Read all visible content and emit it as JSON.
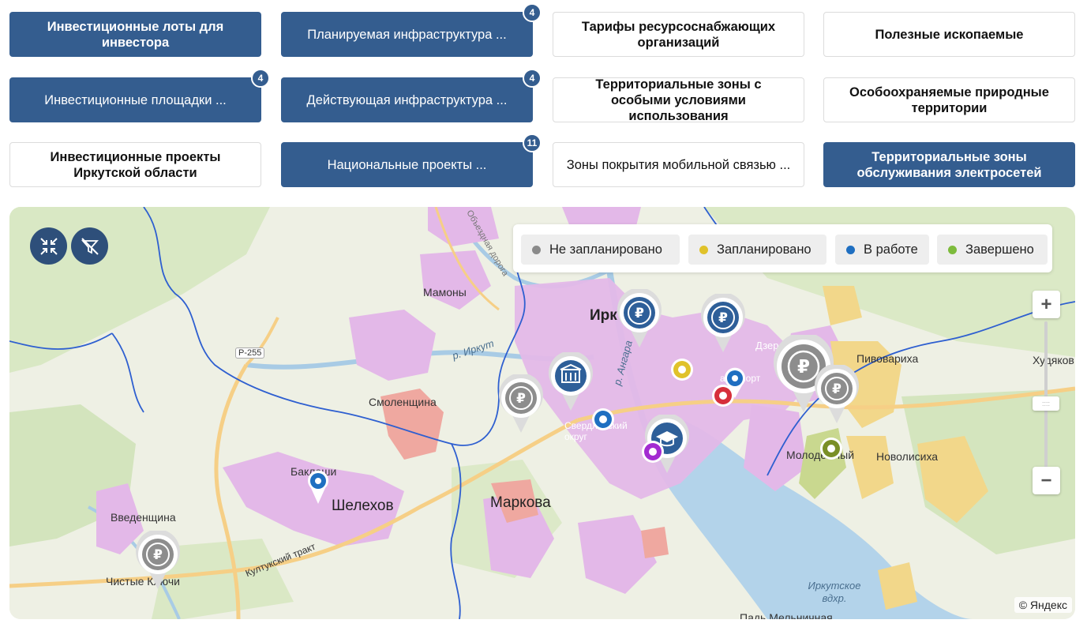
{
  "buttons": [
    {
      "label": "Инвестиционные лоты для инвестора",
      "badge": ""
    },
    {
      "label": "Планируемая инфраструктура ...",
      "badge": "4"
    },
    {
      "label": "Тарифы ресурсоснабжающих организаций",
      "badge": ""
    },
    {
      "label": "Полезные ископаемые",
      "badge": ""
    },
    {
      "label": "Инвестиционные площадки ...",
      "badge": "4"
    },
    {
      "label": "Действующая инфраструктура ...",
      "badge": "4"
    },
    {
      "label": "Территориальные зоны с особыми условиями использования",
      "badge": ""
    },
    {
      "label": "Особоохраняемые природные территории",
      "badge": ""
    },
    {
      "label": "Инвестиционные проекты Иркутской области",
      "badge": ""
    },
    {
      "label": "Национальные проекты ...",
      "badge": "11"
    },
    {
      "label": "Зоны покрытия мобильной связью ...",
      "badge": ""
    },
    {
      "label": "Территориальные зоны обслуживания электросетей",
      "badge": ""
    }
  ],
  "legend": [
    {
      "label": "Не запланировано",
      "color": "#8a8a8a"
    },
    {
      "label": "Запланировано",
      "color": "#e0c22a"
    },
    {
      "label": "В работе",
      "color": "#1f6fc1"
    },
    {
      "label": "Завершено",
      "color": "#7dbb3c"
    }
  ],
  "map": {
    "labels": {
      "mamony": "Мамоны",
      "irkutsk": "Ирк",
      "smolenshchina": "Смоленщина",
      "baklashi": "Баклаши",
      "shelekhov": "Шелехов",
      "markova": "Маркова",
      "vvedenshchina": "Введенщина",
      "chistye_klyuchi": "Чистые Ключи",
      "pivovarikha": "Пивовариха",
      "khudyakovo": "Худяков",
      "molodezhny": "Молодёжный",
      "novolisikha": "Новолисиха",
      "irkutsk_reservoir": "Иркутское вдхр.",
      "pad_melnichnaya": "Падь Мельничная",
      "river_irkut": "р. Иркут",
      "river_angara": "р. Ангара",
      "r255": "Р-255",
      "kultuk_tract": "Култукский тракт",
      "railway": "Объездная дорога",
      "district": "Свердловский округ",
      "airport": "аэропорт",
      "dzer": "Дзер"
    },
    "copyright": "© Яндекс",
    "zoom_in": "+",
    "zoom_out": "−"
  }
}
